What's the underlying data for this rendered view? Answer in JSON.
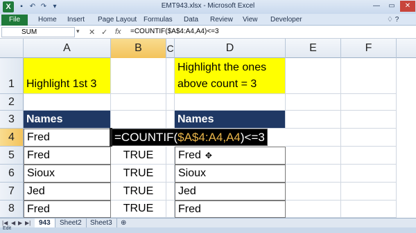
{
  "window": {
    "title": "EMT943.xlsx - Microsoft Excel",
    "app_icon": "X"
  },
  "ribbon": {
    "file": "File",
    "tabs": [
      "Home",
      "Insert",
      "Page Layout",
      "Formulas",
      "Data",
      "Review",
      "View",
      "Developer"
    ]
  },
  "formula_bar": {
    "name_box": "SUM",
    "formula": "=COUNTIF($A$4:A4,A4)<=3"
  },
  "grid": {
    "columns": [
      "A",
      "B",
      "C",
      "D",
      "E",
      "F"
    ],
    "selected_column": "B",
    "rows": [
      "1",
      "2",
      "3",
      "4",
      "5",
      "6",
      "7",
      "8"
    ],
    "selected_row": "4",
    "a1": [
      "Highlight 1st 3"
    ],
    "d1": [
      "Highlight the ones",
      "above count = 3"
    ],
    "a3": "Names",
    "d3": "Names",
    "col_a": [
      "Fred",
      "Fred",
      "Sioux",
      "Jed",
      "Fred"
    ],
    "col_b": [
      "",
      "TRUE",
      "TRUE",
      "TRUE",
      "TRUE"
    ],
    "col_d": [
      "",
      "Fred",
      "Sioux",
      "Jed",
      "Fred"
    ],
    "edit_parts": {
      "pre": "=COUNTIF(",
      "range": "$A$4:A4,A4",
      "post": ")<=3"
    }
  },
  "sheets": {
    "tabs": [
      "943",
      "Sheet2",
      "Sheet3"
    ],
    "active": "943"
  },
  "status": {
    "mode": "Edit"
  },
  "colors": {
    "yellow": "#ffff00",
    "navy": "#1f3864",
    "excel_green": "#1f7a3a"
  }
}
